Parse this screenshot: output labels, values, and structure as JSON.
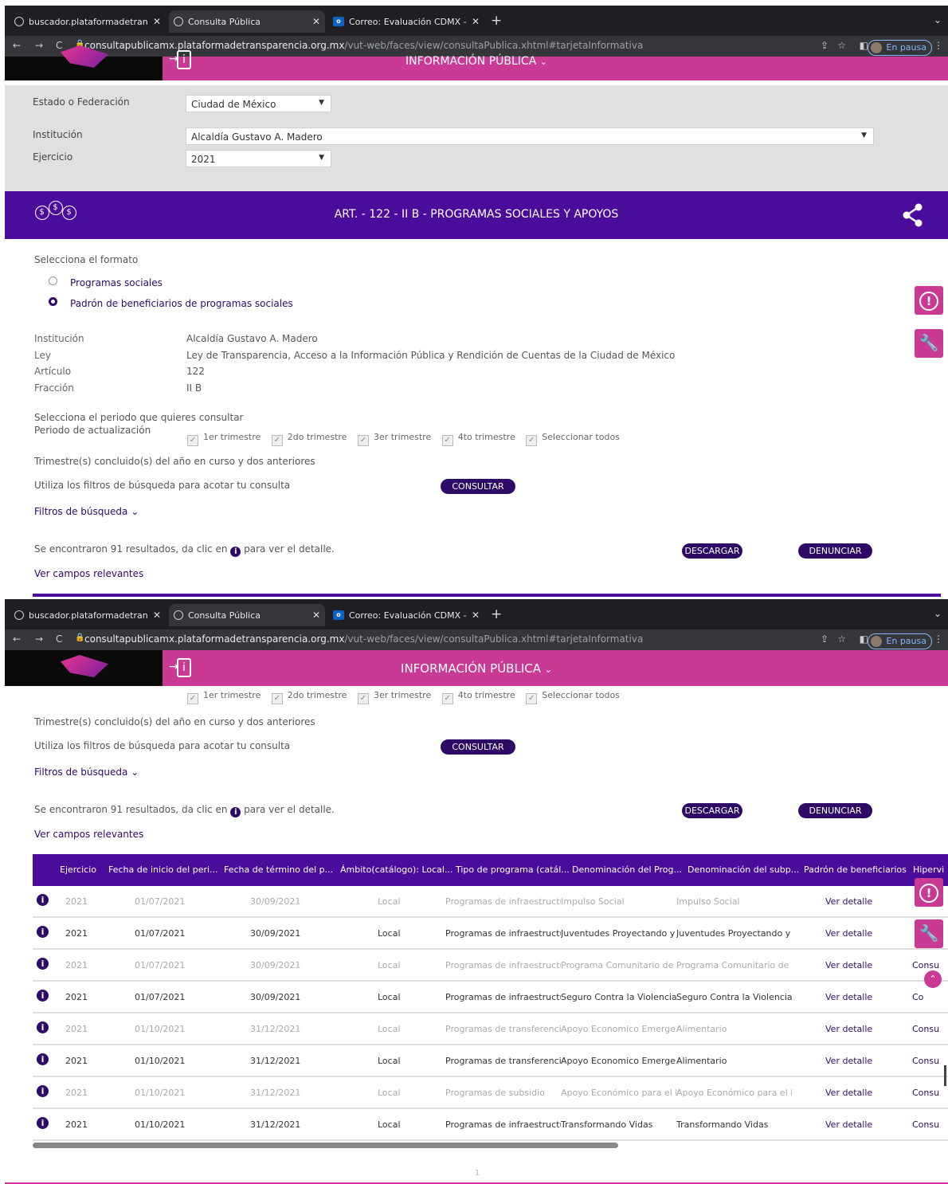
{
  "browser": {
    "tabs": [
      {
        "title": "buscador.plataformadetranspa"
      },
      {
        "title": "Consulta Pública"
      },
      {
        "title": "Correo: Evaluación CDMX - Ou"
      }
    ],
    "url_host": "consultapublicamx.plataformadetransparencia.org.mx",
    "url_path": "/vut-web/faces/view/consultaPublica.xhtml#tarjetaInformativa",
    "profile_status": "En pausa"
  },
  "site_header": {
    "menu_title": "INFORMACIÓN PÚBLICA"
  },
  "filters": {
    "estado_label": "Estado o Federación",
    "estado_value": "Ciudad de México",
    "institucion_label": "Institución",
    "institucion_value": "Alcaldía Gustavo A. Madero",
    "ejercicio_label": "Ejercicio",
    "ejercicio_value": "2021"
  },
  "banner": {
    "title": "ART. - 122 - II B - PROGRAMAS SOCIALES Y APOYOS"
  },
  "format": {
    "label": "Selecciona el formato",
    "options": [
      "Programas sociales",
      "Padrón de beneficiarios de programas sociales"
    ],
    "selected": "Padrón de beneficiarios de programas sociales"
  },
  "details": {
    "institucion_label": "Institución",
    "institucion_value": "Alcaldía Gustavo A. Madero",
    "ley_label": "Ley",
    "ley_value": "Ley de Transparencia, Acceso a la Información Pública y Rendición de Cuentas de la Ciudad de México",
    "articulo_label": "Artículo",
    "articulo_value": "122",
    "fraccion_label": "Fracción",
    "fraccion_value": "II B"
  },
  "period": {
    "select_label": "Selecciona el periodo que quieres consultar",
    "update_label": "Periodo de actualización",
    "options": [
      "1er trimestre",
      "2do trimestre",
      "3er trimestre",
      "4to trimestre",
      "Seleccionar todos"
    ],
    "note": "Trimestre(s) concluido(s) del año en curso y dos anteriores"
  },
  "search": {
    "hint": "Utiliza los filtros de búsqueda para acotar tu consulta",
    "consult_button": "CONSULTAR",
    "filters_link": "Filtros de búsqueda",
    "results_prefix": "Se encontraron 91 resultados, da clic en",
    "results_suffix": "para ver el detalle.",
    "download_button": "DESCARGAR",
    "report_button": "DENUNCIAR",
    "relevant_fields": "Ver campos relevantes"
  },
  "table": {
    "headers": [
      "Ejercicio",
      "Fecha de inicio del peri...",
      "Fecha de término del p...",
      "Ámbito(catálogo): Local...",
      "Tipo de programa (catál...",
      "Denominación del Prog...",
      "Denominación del subp...",
      "Padrón de beneficiarios",
      "Hipervi"
    ],
    "rows": [
      {
        "ejercicio": "2021",
        "inicio": "01/07/2021",
        "termino": "30/09/2021",
        "ambito": "Local",
        "tipo": "Programas de infraestructu...",
        "programa": "Impulso Social",
        "subprograma": "Impulso Social",
        "padron": "Ver detalle",
        "hiper": ""
      },
      {
        "ejercicio": "2021",
        "inicio": "01/07/2021",
        "termino": "30/09/2021",
        "ambito": "Local",
        "tipo": "Programas de infraestructu...",
        "programa": "Juventudes Proyectando y T...",
        "subprograma": "Juventudes Proyectando y T...",
        "padron": "Ver detalle",
        "hiper": ""
      },
      {
        "ejercicio": "2021",
        "inicio": "01/07/2021",
        "termino": "30/09/2021",
        "ambito": "Local",
        "tipo": "Programas de infraestructu...",
        "programa": "Programa Comunitario de ...",
        "subprograma": "Programa Comunitario de ...",
        "padron": "Ver detalle",
        "hiper": "Consu"
      },
      {
        "ejercicio": "2021",
        "inicio": "01/07/2021",
        "termino": "30/09/2021",
        "ambito": "Local",
        "tipo": "Programas de infraestructu...",
        "programa": "Seguro Contra la Violencia d...",
        "subprograma": "Seguro Contra la Violencia d...",
        "padron": "Ver detalle",
        "hiper": "Co"
      },
      {
        "ejercicio": "2021",
        "inicio": "01/10/2021",
        "termino": "31/12/2021",
        "ambito": "Local",
        "tipo": "Programas de transferencia",
        "programa": "Apoyo Economico Emergen...",
        "subprograma": "Alimentario",
        "padron": "Ver detalle",
        "hiper": "Consu"
      },
      {
        "ejercicio": "2021",
        "inicio": "01/10/2021",
        "termino": "31/12/2021",
        "ambito": "Local",
        "tipo": "Programas de transferencia",
        "programa": "Apoyo Economico Emergen...",
        "subprograma": "Alimentario",
        "padron": "Ver detalle",
        "hiper": "Consu"
      },
      {
        "ejercicio": "2021",
        "inicio": "01/10/2021",
        "termino": "31/12/2021",
        "ambito": "Local",
        "tipo": "Programas de subsidio",
        "programa": "Apoyo Económico para el P...",
        "subprograma": "Apoyo Económico para el P...",
        "padron": "Ver detalle",
        "hiper": "Consu"
      },
      {
        "ejercicio": "2021",
        "inicio": "01/10/2021",
        "termino": "31/12/2021",
        "ambito": "Local",
        "tipo": "Programas de infraestructu...",
        "programa": "Transformando Vidas",
        "subprograma": "Transformando Vidas",
        "padron": "Ver detalle",
        "hiper": "Consu"
      }
    ]
  },
  "pagination": {
    "page": "1"
  },
  "colors": {
    "header_pink": "#c93a95",
    "banner_purple": "#4b0c9b",
    "button_purple": "#2d0a66"
  }
}
